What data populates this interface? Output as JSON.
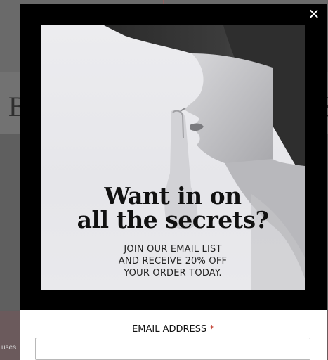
{
  "background_page": {
    "letter_left": "B",
    "letter_right": "S",
    "cookie_text": "uses"
  },
  "modal": {
    "close_symbol": "✕",
    "headline_line1": "Want in on",
    "headline_line2": "all the secrets?",
    "offer_line1": "JOIN OUR EMAIL LIST",
    "offer_line2": "AND RECEIVE 20% OFF",
    "offer_line3": "YOUR ORDER TODAY.",
    "email_label": "EMAIL ADDRESS",
    "required_marker": "*",
    "email_value": "",
    "email_placeholder": ""
  },
  "icons": {
    "close": "close-icon",
    "hero": "woman-shush-photo"
  },
  "colors": {
    "overlay": "#6b6b6b",
    "modal_bg": "#000000",
    "required": "#c0392b"
  }
}
